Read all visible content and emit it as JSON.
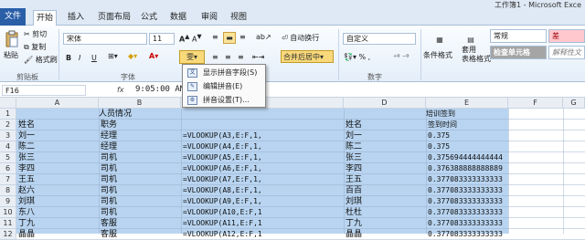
{
  "window": {
    "title": "工作簿1 - Microsoft Exce"
  },
  "tabs": [
    {
      "label": "文件"
    },
    {
      "label": "开始"
    },
    {
      "label": "插入"
    },
    {
      "label": "页面布局"
    },
    {
      "label": "公式"
    },
    {
      "label": "数据"
    },
    {
      "label": "审阅"
    },
    {
      "label": "视图"
    }
  ],
  "ribbon": {
    "clipboard": {
      "paste": "粘贴",
      "cut": "剪切",
      "copy": "复制",
      "format_painter": "格式刷",
      "group": "剪贴板"
    },
    "font": {
      "name": "宋体",
      "size": "11",
      "group": "字体",
      "bold": "B",
      "italic": "I",
      "underline": "U"
    },
    "alignment": {
      "wrap": "自动换行",
      "merge": "合并后居中"
    },
    "number": {
      "format": "自定义",
      "group": "数字"
    },
    "styles": {
      "conditional": "条件格式",
      "table": "套用\n表格格式",
      "normal": "常规",
      "bad": "差",
      "check": "检查单元格",
      "explain": "解释性文"
    }
  },
  "menu": {
    "items": [
      {
        "label": "显示拼音字段(S)",
        "icon": "pinyin-show-icon"
      },
      {
        "label": "编辑拼音(E)",
        "icon": "pinyin-edit-icon"
      },
      {
        "label": "拼音设置(T)...",
        "icon": "pinyin-settings-icon"
      }
    ]
  },
  "formula_bar": {
    "name_box": "F16",
    "fx": "fx",
    "value": "9:05:00 AM"
  },
  "columns": [
    "A",
    "B",
    "C",
    "D",
    "E",
    "F",
    "G"
  ],
  "rows": [
    {
      "n": "1",
      "a": "",
      "b": "人员情况",
      "c": "",
      "e": "",
      "f": "培训签到"
    },
    {
      "n": "2",
      "a": "姓名",
      "b": "职务",
      "c": "",
      "e": "姓名",
      "f": "签到时间"
    },
    {
      "n": "3",
      "a": "刘一",
      "b": "经理",
      "c": "=VLOOKUP(A3,E:F,1,",
      "e": "刘一",
      "f": "0.375"
    },
    {
      "n": "4",
      "a": "陈二",
      "b": "经理",
      "c": "=VLOOKUP(A4,E:F,1,",
      "e": "陈二",
      "f": "0.375"
    },
    {
      "n": "5",
      "a": "张三",
      "b": "司机",
      "c": "=VLOOKUP(A5,E:F,1,",
      "e": "张三",
      "f": "0.375694444444444"
    },
    {
      "n": "6",
      "a": "李四",
      "b": "司机",
      "c": "=VLOOKUP(A6,E:F,1,",
      "e": "李四",
      "f": "0.376388888888889"
    },
    {
      "n": "7",
      "a": "王五",
      "b": "司机",
      "c": "=VLOOKUP(A7,E:F,1,",
      "e": "王五",
      "f": "0.377083333333333"
    },
    {
      "n": "8",
      "a": "赵六",
      "b": "司机",
      "c": "=VLOOKUP(A8,E:F,1,",
      "e": "百百",
      "f": "0.377083333333333"
    },
    {
      "n": "9",
      "a": "刘琪",
      "b": "司机",
      "c": "=VLOOKUP(A9,E:F,1,",
      "e": "刘琪",
      "f": "0.377083333333333"
    },
    {
      "n": "10",
      "a": "东八",
      "b": "司机",
      "c": "=VLOOKUP(A10,E:F,1",
      "e": "杜杜",
      "f": "0.377083333333333"
    },
    {
      "n": "11",
      "a": "丁九",
      "b": "客服",
      "c": "=VLOOKUP(A11,E:F,1",
      "e": "丁九",
      "f": "0.377083333333333"
    },
    {
      "n": "12",
      "a": "晶晶",
      "b": "客服",
      "c": "=VLOOKUP(A12,E:F,1",
      "e": "晶晶",
      "f": "0.377083333333333"
    }
  ]
}
